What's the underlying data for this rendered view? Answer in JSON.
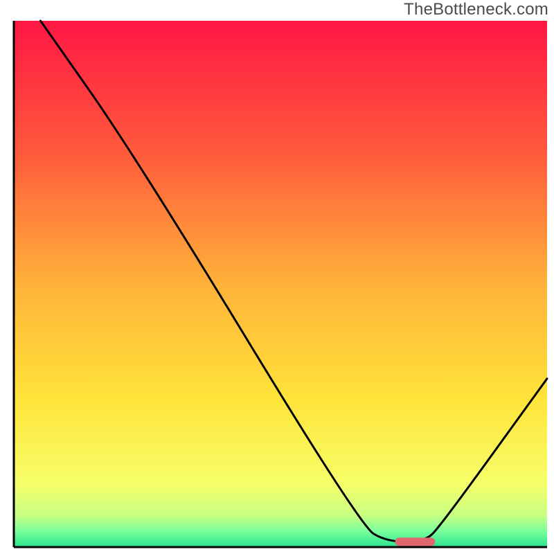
{
  "watermark": "TheBottleneck.com",
  "chart_data": {
    "type": "line",
    "title": "",
    "xlabel": "",
    "ylabel": "",
    "xlim": [
      0,
      100
    ],
    "ylim": [
      0,
      100
    ],
    "grid": false,
    "legend": null,
    "series": [
      {
        "name": "bottleneck-curve",
        "color": "#000000",
        "points": [
          {
            "x": 5.0,
            "y": 100.0
          },
          {
            "x": 23.0,
            "y": 74.0
          },
          {
            "x": 65.0,
            "y": 4.0
          },
          {
            "x": 70.0,
            "y": 1.0
          },
          {
            "x": 77.0,
            "y": 1.0
          },
          {
            "x": 80.0,
            "y": 4.0
          },
          {
            "x": 100.0,
            "y": 32.0
          }
        ]
      }
    ],
    "marker": {
      "x_start": 71.5,
      "x_end": 79.0,
      "y": 1.0,
      "color": "#e0666f"
    },
    "background_gradient": {
      "stops": [
        {
          "pct": 0,
          "color": "#ff1744"
        },
        {
          "pct": 25,
          "color": "#ff5a3c"
        },
        {
          "pct": 50,
          "color": "#ffb23a"
        },
        {
          "pct": 72,
          "color": "#ffe43a"
        },
        {
          "pct": 88,
          "color": "#f6ff6a"
        },
        {
          "pct": 94,
          "color": "#c7ff82"
        },
        {
          "pct": 97,
          "color": "#7aff9c"
        },
        {
          "pct": 100,
          "color": "#28e38e"
        }
      ]
    },
    "axes": {
      "show_frame": true,
      "color": "#000000"
    }
  }
}
